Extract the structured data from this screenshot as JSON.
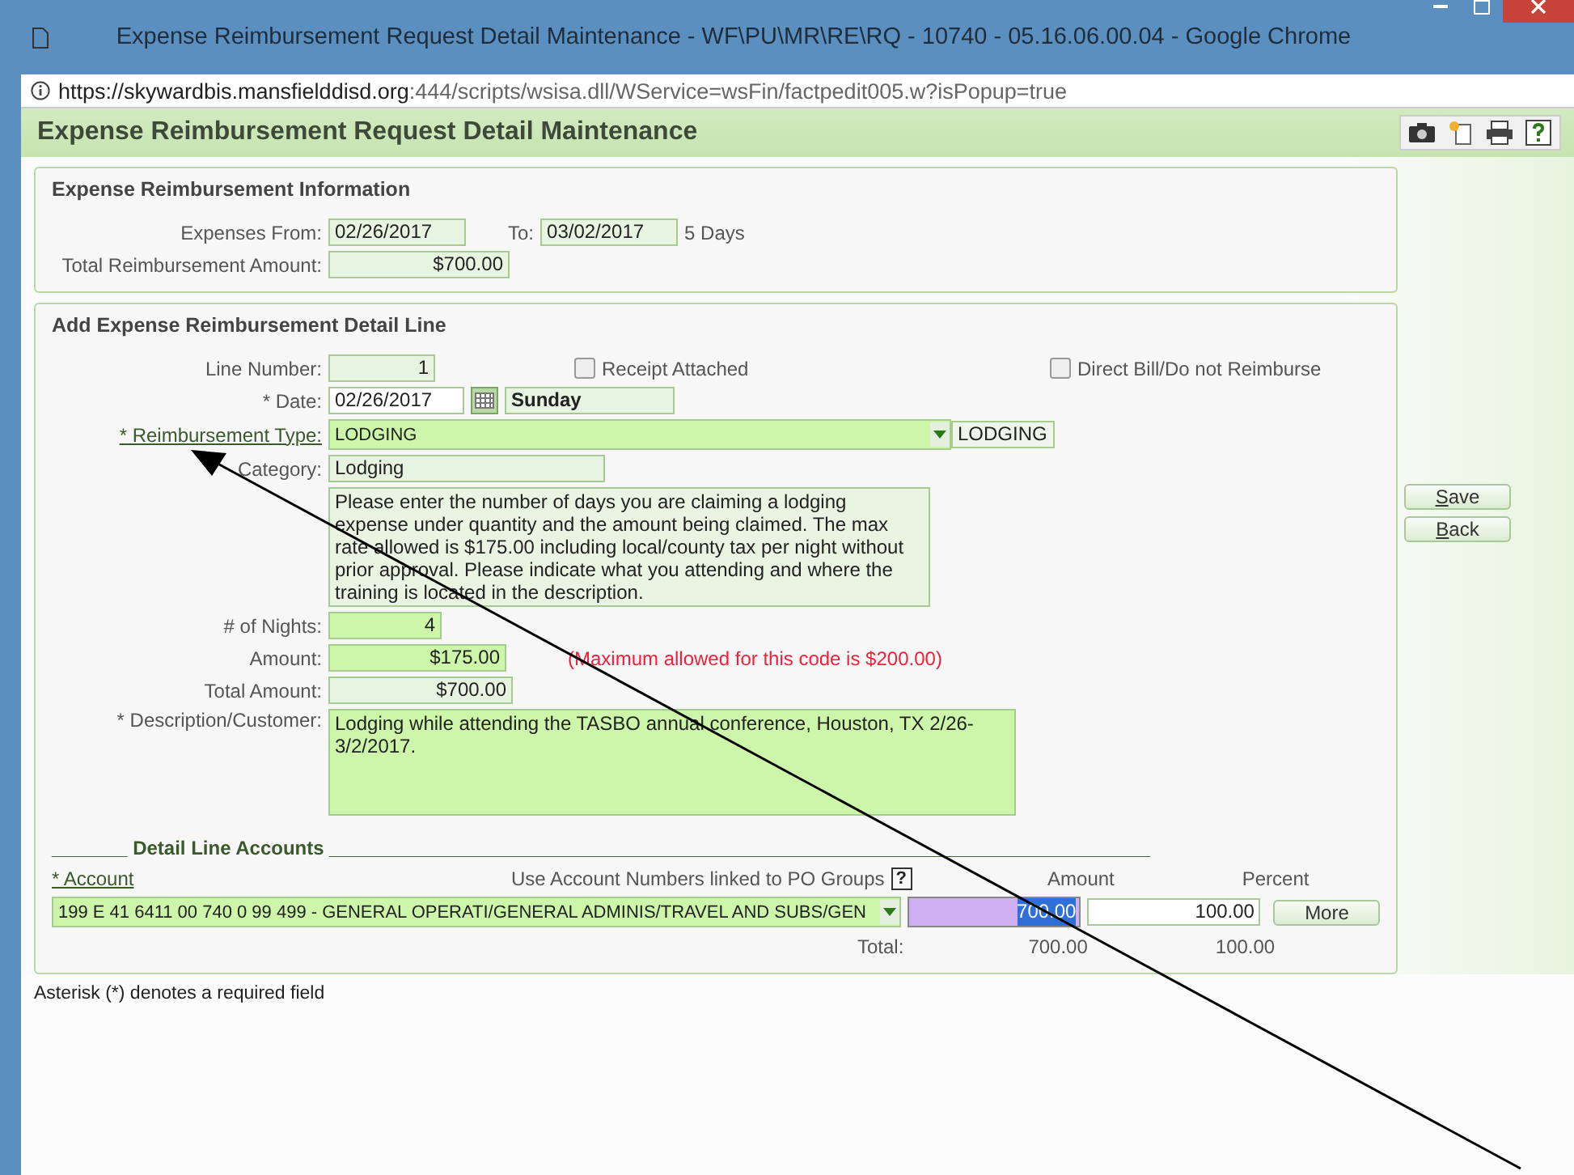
{
  "window": {
    "title": "Expense Reimbursement Request Detail Maintenance - WF\\PU\\MR\\RE\\RQ - 10740 - 05.16.06.00.04 - Google Chrome",
    "url_host": "https://skywardbis.mansfielddisd.org",
    "url_rest": ":444/scripts/wsisa.dll/WService=wsFin/factpedit005.w?isPopup=true"
  },
  "page_title": "Expense Reimbursement Request Detail Maintenance",
  "info": {
    "title": "Expense Reimbursement Information",
    "from_label": "Expenses From:",
    "from": "02/26/2017",
    "to_label": "To:",
    "to": "03/02/2017",
    "days": "5 Days",
    "total_label": "Total Reimbursement Amount:",
    "total": "$700.00"
  },
  "detail": {
    "title": "Add Expense Reimbursement Detail Line",
    "line_label": "Line Number:",
    "line": "1",
    "receipt": {
      "label": "Receipt Attached",
      "checked": false
    },
    "direct_bill": {
      "label": "Direct Bill/Do not Reimburse",
      "checked": false
    },
    "date_label": "* Date:",
    "date": "02/26/2017",
    "weekday": "Sunday",
    "type_label": "* Reimbursement Type:",
    "type": "LODGING",
    "type_code": "LODGING",
    "category_label": "Category:",
    "category": "Lodging",
    "instructions": "Please enter the number of days you are claiming a lodging expense under quantity and the amount being claimed.  The max rate allowed is $175.00 including local/county tax per night without prior approval.  Please indicate what you attending and where the training is located in the description.",
    "nights_label": "# of Nights:",
    "nights": "4",
    "amount_label": "Amount:",
    "amount": "$175.00",
    "max_note": "(Maximum allowed for this code is $200.00)",
    "total_label": "Total Amount:",
    "total": "$700.00",
    "desc_label": "* Description/Customer:",
    "desc": "Lodging while attending the TASBO annual conference, Houston, TX 2/26-3/2/2017."
  },
  "accounts": {
    "title_pre": "_______",
    "title": "Detail Line Accounts",
    "title_post": "____________________________________________________________________________",
    "account_label": "* Account",
    "po_label": "Use Account Numbers linked to PO Groups",
    "help": "?",
    "amount_label": "Amount",
    "percent_label": "Percent",
    "rows": [
      {
        "account": "199 E 41 6411 00 740 0 99 499 - GENERAL OPERATI/GENERAL ADMINIS/TRAVEL AND SUBS/GEN",
        "amount": "700.00",
        "amount_selected": true,
        "percent": "100.00",
        "more": "More"
      }
    ],
    "total_label": "Total:",
    "total_amount": "700.00",
    "total_percent": "100.00"
  },
  "buttons": [
    {
      "label": "Save"
    },
    {
      "label": "Back"
    }
  ],
  "footnote": "Asterisk (*) denotes a required field"
}
